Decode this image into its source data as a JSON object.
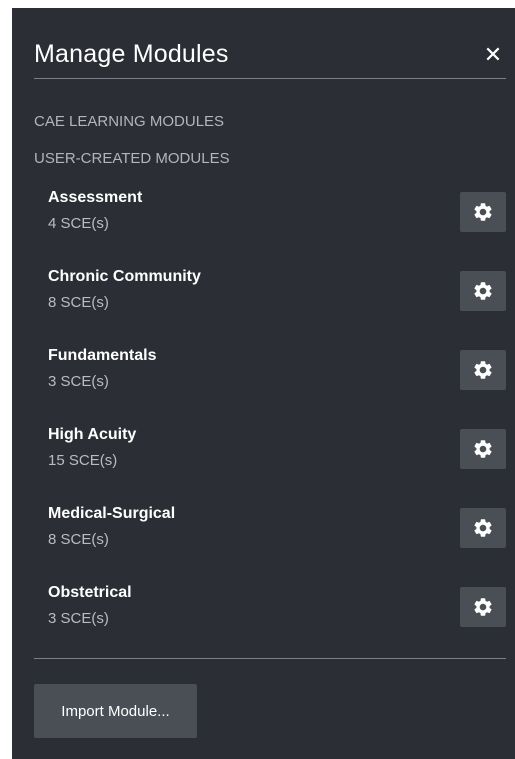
{
  "dialog": {
    "title": "Manage Modules",
    "close_label": "✕"
  },
  "sections": {
    "cae_label": "CAE LEARNING MODULES",
    "user_label": "USER-CREATED MODULES"
  },
  "modules": [
    {
      "name": "Assessment",
      "count": "4 SCE(s)"
    },
    {
      "name": "Chronic Community",
      "count": "8 SCE(s)"
    },
    {
      "name": "Fundamentals",
      "count": "3 SCE(s)"
    },
    {
      "name": "High Acuity",
      "count": "15 SCE(s)"
    },
    {
      "name": "Medical-Surgical",
      "count": "8 SCE(s)"
    },
    {
      "name": "Obstetrical",
      "count": "3 SCE(s)"
    }
  ],
  "footer": {
    "import_label": "Import Module..."
  },
  "icons": {
    "close": "close-icon",
    "settings": "gear-icon"
  },
  "colors": {
    "panel_bg": "#2b2f35",
    "button_bg": "#4a4f56",
    "section_text": "#b2b6bb",
    "text": "#ffffff"
  }
}
